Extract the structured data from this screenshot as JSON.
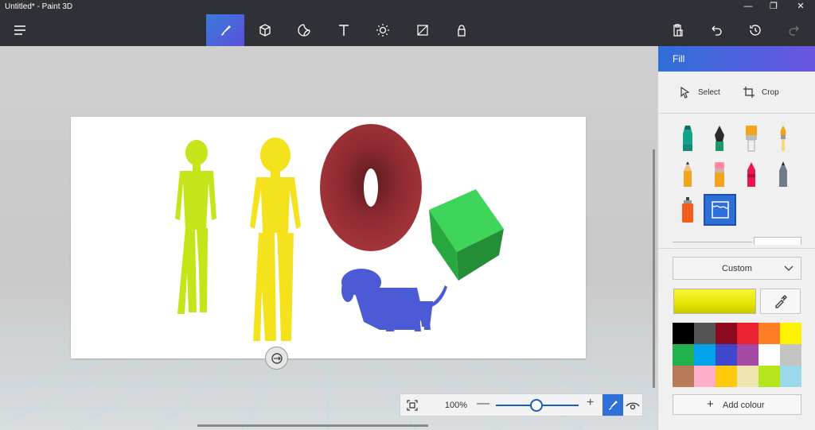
{
  "window": {
    "title": "Untitled* - Paint 3D",
    "minimize": "—",
    "restore": "❐",
    "close": "✕"
  },
  "toolbar": {
    "tools": [
      {
        "name": "brushes",
        "icon": "brush-icon"
      },
      {
        "name": "3d-shapes",
        "icon": "cube-icon"
      },
      {
        "name": "stickers",
        "icon": "sticker-icon"
      },
      {
        "name": "text",
        "icon": "text-icon"
      },
      {
        "name": "effects",
        "icon": "sun-icon"
      },
      {
        "name": "canvas",
        "icon": "canvas-icon"
      },
      {
        "name": "3d-library",
        "icon": "library-icon"
      }
    ],
    "right": [
      {
        "name": "paste",
        "icon": "paste-icon"
      },
      {
        "name": "undo",
        "icon": "undo-icon"
      },
      {
        "name": "history",
        "icon": "history-icon"
      },
      {
        "name": "redo",
        "icon": "redo-icon"
      }
    ]
  },
  "zoom": {
    "value": "100%",
    "minus": "—",
    "plus": "+"
  },
  "panel": {
    "title": "Fill",
    "select_label": "Select",
    "crop_label": "Crop",
    "dropdown_value": "Custom",
    "add_colour_label": "Add colour",
    "add_colour_plus": "+",
    "selected_color": "#ffff00",
    "brushes": [
      {
        "name": "marker",
        "icon": "marker-icon"
      },
      {
        "name": "calligraphy-pen",
        "icon": "calligraphy-pen-icon"
      },
      {
        "name": "oil-brush",
        "icon": "oil-brush-icon"
      },
      {
        "name": "watercolour",
        "icon": "watercolour-icon"
      },
      {
        "name": "pencil",
        "icon": "pencil-icon"
      },
      {
        "name": "eraser",
        "icon": "eraser-icon"
      },
      {
        "name": "crayon",
        "icon": "crayon-icon"
      },
      {
        "name": "pixel-pen",
        "icon": "pixel-pen-icon"
      },
      {
        "name": "spray-can",
        "icon": "spray-can-icon"
      },
      {
        "name": "fill",
        "icon": "fill-bucket-icon"
      }
    ],
    "palette": [
      "#000000",
      "#555555",
      "#8b0a1e",
      "#e8202f",
      "#ff7e27",
      "#fff200",
      "#23b14d",
      "#00a2e8",
      "#3f48cc",
      "#a349a4",
      "#ffffff",
      "#c3c3c3",
      "#b97a57",
      "#ffaec9",
      "#ffc90e",
      "#efe4b0",
      "#b5e61d",
      "#99d9ea"
    ]
  }
}
